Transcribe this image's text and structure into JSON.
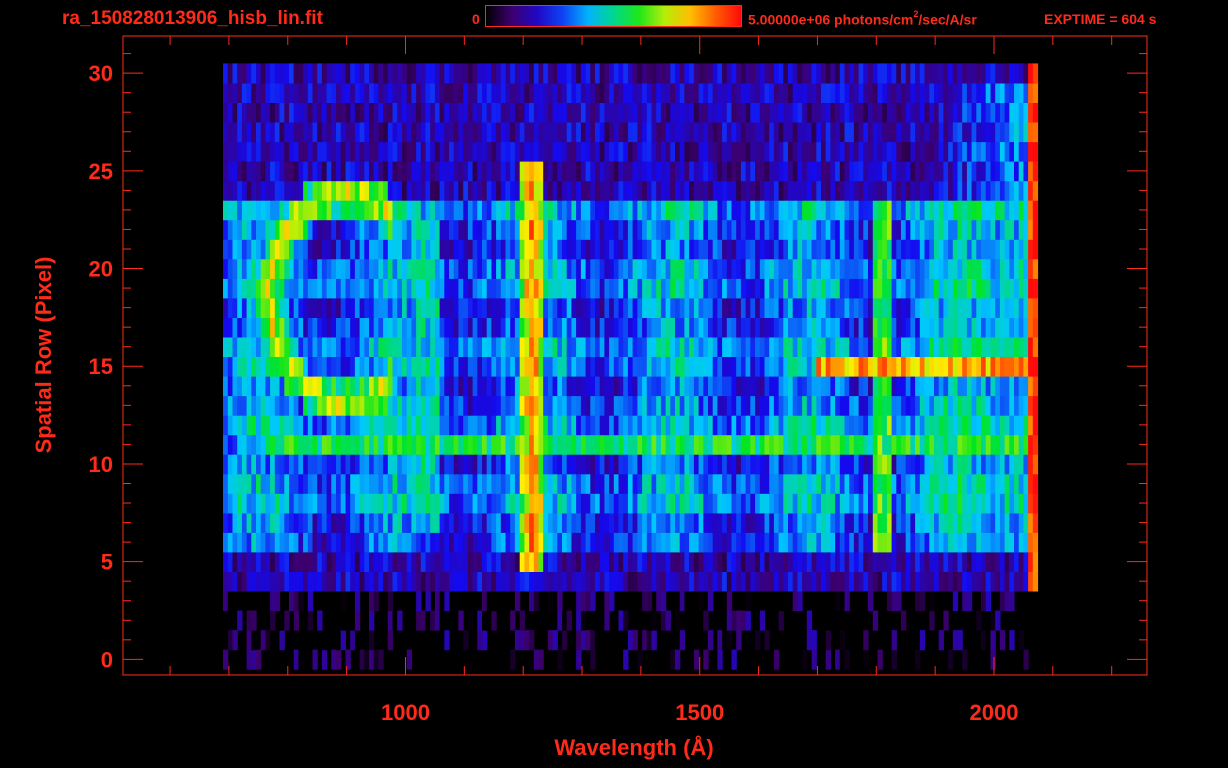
{
  "header": {
    "filename": "ra_150828013906_hisb_lin.fit",
    "colorbar_min": "0",
    "colorbar_max": "5.00000e+06",
    "colorbar_unit_pre": " photons/cm",
    "colorbar_unit_sup": "2",
    "colorbar_unit_post": "/sec/A/sr",
    "exptime": "EXPTIME = 604 s"
  },
  "colors": {
    "text": "#ff2a1a",
    "frame": "#ff2a1a",
    "background": "#000000"
  },
  "chart_data": {
    "type": "heatmap",
    "title": "",
    "xlabel": "Wavelength (Å)",
    "ylabel": "Spatial Row (Pixel)",
    "xlim": [
      520,
      2260
    ],
    "ylim": [
      -0.8,
      31.9
    ],
    "xticks": [
      1000,
      1500,
      2000
    ],
    "yticks": [
      0,
      5,
      10,
      15,
      20,
      25,
      30
    ],
    "x_range_data": [
      690,
      2070
    ],
    "colormap": "rainbow (black → purple → blue → cyan → green → yellow → red)",
    "color_range": [
      0,
      5000000
    ],
    "features": [
      {
        "kind": "emission_line",
        "x": 1216,
        "rows": [
          5,
          25
        ],
        "level": 0.88
      },
      {
        "kind": "emission_band",
        "x": 1035,
        "rows": [
          7,
          22
        ],
        "level": 0.45
      },
      {
        "kind": "emission_band",
        "x": 1810,
        "rows": [
          6,
          23
        ],
        "level": 0.6
      },
      {
        "kind": "bright_row",
        "row": 15,
        "x": [
          1700,
          2070
        ],
        "level": 0.82
      },
      {
        "kind": "bright_row",
        "row": 11,
        "x": [
          760,
          2070
        ],
        "level": 0.55
      },
      {
        "kind": "edge_line",
        "x": 2065,
        "rows": [
          2,
          30
        ],
        "level": 0.95
      },
      {
        "kind": "arc",
        "x": [
          760,
          970
        ],
        "rows": [
          13,
          24
        ],
        "level": 0.75
      }
    ]
  }
}
